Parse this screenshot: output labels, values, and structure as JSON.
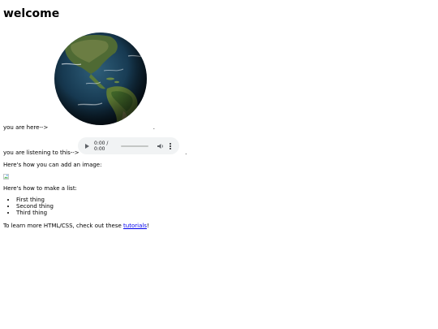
{
  "page": {
    "heading": "welcome",
    "globe_icon": "earth-globe-americas",
    "location_label": "you are here-->",
    "location_trailing": ".",
    "audio_label": "you are listening to this-->",
    "audio_trailing": ".",
    "audio_player": {
      "time": "0:00 / 0:00",
      "play_icon": "play-icon",
      "volume_icon": "volume-icon",
      "more_icon": "more-vertical-icon",
      "progress": 0
    },
    "image_intro": "Here's how you can add an image:",
    "broken_image_icon": "broken-image-icon",
    "list_intro": "Here's how to make a list:",
    "list_items": [
      "First thing",
      "Second thing",
      "Third thing"
    ],
    "footer_prefix": "To learn more HTML/CSS, check out these ",
    "footer_link": "tutorials",
    "footer_suffix": "!"
  },
  "colors": {
    "link": "#0000ee",
    "audio_bg": "#f1f3f4"
  }
}
